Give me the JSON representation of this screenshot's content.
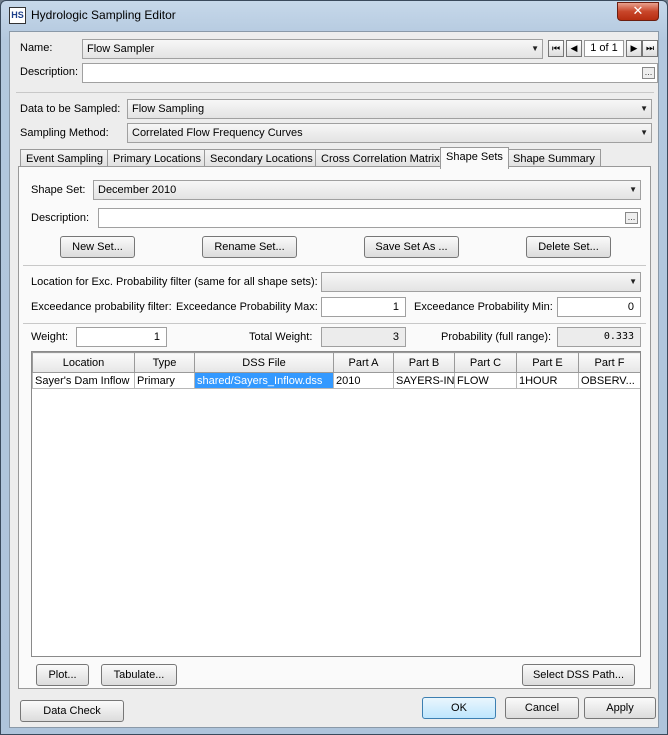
{
  "window": {
    "title": "Hydrologic Sampling Editor",
    "icon_text": "HS",
    "close": "✕"
  },
  "name": {
    "label": "Name:",
    "value": "Flow Sampler",
    "nav": [
      "⏮",
      "◀"
    ],
    "record": "1 of 1",
    "nav2": [
      "▶",
      "⏭"
    ]
  },
  "description": {
    "label": "Description:",
    "value": ""
  },
  "data_sampled": {
    "label": "Data to be Sampled:",
    "value": "Flow Sampling"
  },
  "sampling_method": {
    "label": "Sampling Method:",
    "value": "Correlated Flow Frequency Curves"
  },
  "tabs": [
    "Event Sampling",
    "Primary Locations",
    "Secondary Locations",
    "Cross Correlation Matrix",
    "Shape Sets",
    "Shape Summary"
  ],
  "active_tab": "Shape Sets",
  "shape_set": {
    "label": "Shape Set:",
    "value": "December 2010"
  },
  "shape_desc": {
    "label": "Description:",
    "value": ""
  },
  "set_buttons": {
    "new": "New Set...",
    "rename": "Rename Set...",
    "save_as": "Save Set As ...",
    "delete": "Delete Set..."
  },
  "filter_location": {
    "label": "Location for Exc. Probability filter (same for all shape sets):",
    "value": ""
  },
  "exceedance": {
    "label": "Exceedance probability filter:",
    "max_label": "Exceedance Probability Max:",
    "max_value": "1",
    "min_label": "Exceedance Probability Min:",
    "min_value": "0"
  },
  "weights": {
    "weight_label": "Weight:",
    "weight_value": "1",
    "total_label": "Total Weight:",
    "total_value": "3",
    "prob_label": "Probability (full range):",
    "prob_value": "0.333"
  },
  "table": {
    "columns": [
      "Location",
      "Type",
      "DSS File",
      "Part A",
      "Part B",
      "Part C",
      "Part E",
      "Part F"
    ],
    "rows": [
      [
        "Sayer's Dam Inflow",
        "Primary",
        "shared/Sayers_Inflow.dss",
        "2010",
        "SAYERS-IN",
        "FLOW",
        "1HOUR",
        "OBSERV..."
      ]
    ]
  },
  "panel_buttons": {
    "plot": "Plot...",
    "tabulate": "Tabulate...",
    "select_dss": "Select DSS Path..."
  },
  "footer": {
    "data_check": "Data Check",
    "ok": "OK",
    "cancel": "Cancel",
    "apply": "Apply"
  },
  "colors": {
    "selection": "#3399ff",
    "close": "#c8462a",
    "frame": "#b3c8de"
  },
  "icons": {
    "dropdown": "chevron-down-icon",
    "ellipsis": "ellipsis-icon",
    "first": "first-record-icon",
    "prev": "prev-record-icon",
    "next": "next-record-icon",
    "last": "last-record-icon"
  }
}
